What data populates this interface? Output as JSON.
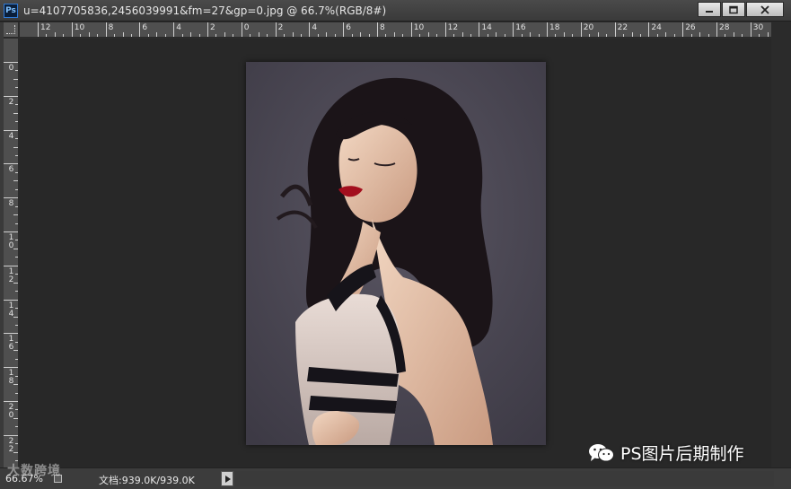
{
  "window": {
    "app_badge": "Ps",
    "title": "u=4107705836,2456039991&fm=27&gp=0.jpg @ 66.7%(RGB/8#)"
  },
  "rulers": {
    "horizontal": [
      "12",
      "10",
      "8",
      "6",
      "4",
      "2",
      "0",
      "2",
      "4",
      "6",
      "8",
      "10",
      "12",
      "14",
      "16",
      "18",
      "20",
      "22",
      "24",
      "26",
      "28",
      "30"
    ],
    "vertical": [
      "0",
      "2",
      "4",
      "6",
      "8",
      "10",
      "12",
      "14",
      "16",
      "18",
      "20",
      "22"
    ]
  },
  "status": {
    "zoom": "66.67%",
    "doc_info": "文档:939.0K/939.0K"
  },
  "watermarks": {
    "left": "大数跨境",
    "right": "PS图片后期制作"
  },
  "icons": {
    "badge": "photoshop-logo-icon",
    "minimize": "minimize-icon",
    "maximize": "maximize-icon",
    "close": "close-icon",
    "wechat": "wechat-icon"
  },
  "colors": {
    "canvas_bg": "#282828",
    "ruler_bg": "#4f4f4f",
    "photo_bg": "#4e4a56"
  }
}
